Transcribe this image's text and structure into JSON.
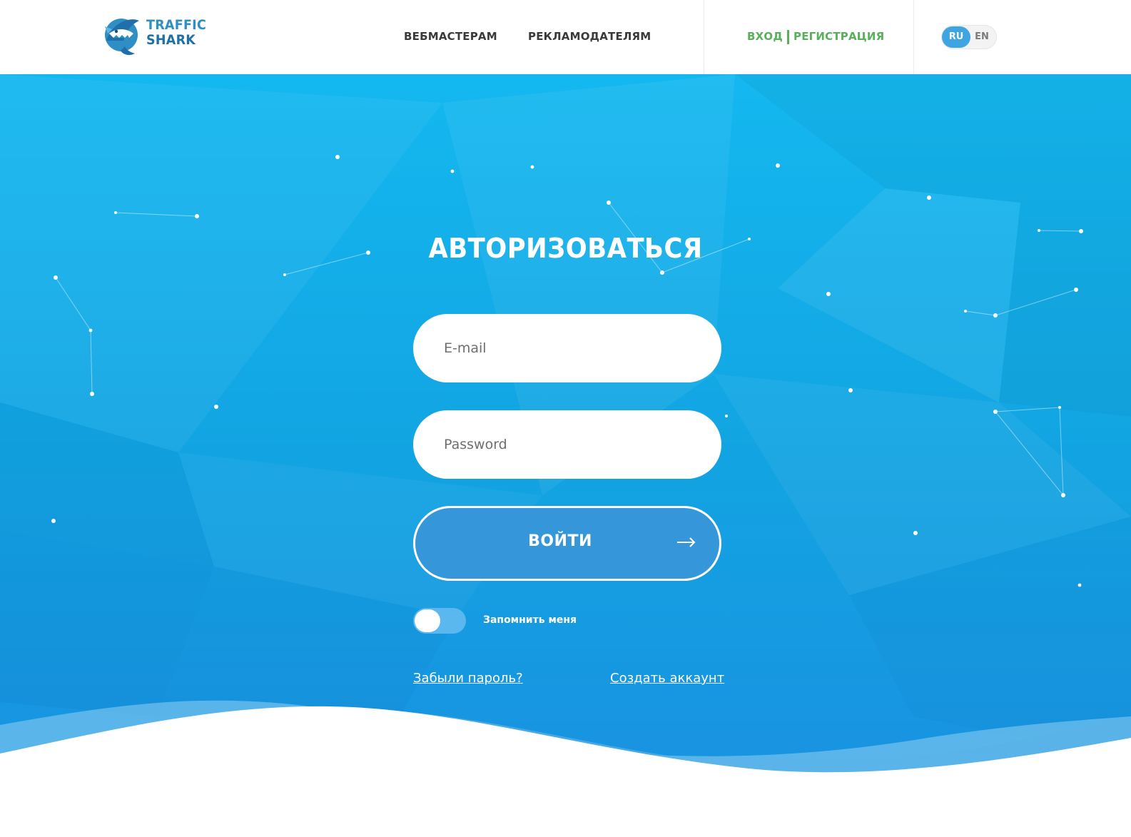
{
  "header": {
    "logo": {
      "line1": "TRAFFIC",
      "line2": "SHARK"
    },
    "nav": [
      {
        "label": "ВЕБМАСТЕРАМ"
      },
      {
        "label": "РЕКЛАМОДАТЕЛЯМ"
      }
    ],
    "auth": {
      "login": "ВХОД",
      "register": "РЕГИСТРАЦИЯ"
    },
    "lang": {
      "active": "RU",
      "other": "EN"
    }
  },
  "login_form": {
    "title": "АВТОРИЗОВАТЬСЯ",
    "email_placeholder": "E-mail",
    "password_placeholder": "Password",
    "submit_label": "ВОЙТИ",
    "remember_label": "Запомнить меня",
    "remember_checked": false,
    "forgot_link": "Забыли пароль?",
    "create_link": "Создать аккаунт"
  },
  "colors": {
    "accent_green": "#58b05a",
    "hero_blue": "#1aa6e8",
    "button_blue": "#3596da",
    "lang_active": "#3ea4e2"
  }
}
